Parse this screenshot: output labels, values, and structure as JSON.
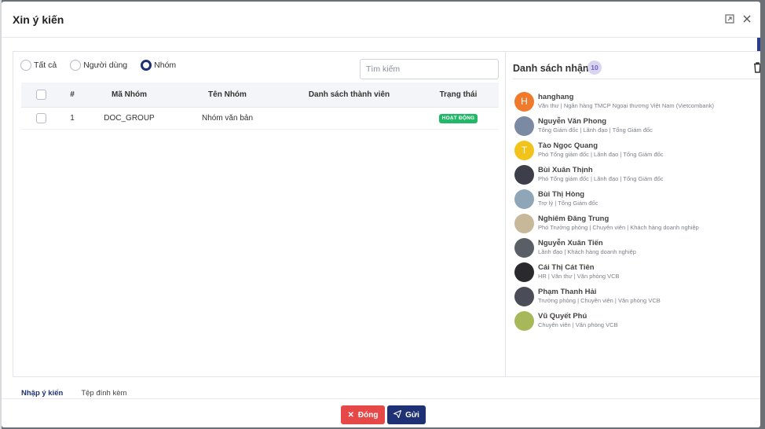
{
  "modal": {
    "title": "Xin ý kiến",
    "expand_icon": "expand-icon",
    "close_icon": "close-icon"
  },
  "filter": {
    "options": [
      "Tất cả",
      "Người dùng",
      "Nhóm"
    ],
    "selected": "Nhóm",
    "search_placeholder": "Tìm kiếm"
  },
  "table": {
    "headers": [
      "#",
      "Mã Nhóm",
      "Tên Nhóm",
      "Danh sách thành viên",
      "Trạng thái"
    ],
    "rows": [
      {
        "num": "1",
        "code": "DOC_GROUP",
        "name": "Nhóm văn bản",
        "members": "",
        "status": "HOẠT ĐỘNG"
      }
    ]
  },
  "recipients_panel": {
    "title": "Danh sách nhận",
    "count": "10",
    "items": [
      {
        "initial": "H",
        "color": "#ef7a2b",
        "name": "hanghang",
        "desc": "Văn thư | Ngân hàng TMCP Ngoại thương Việt Nam (Vietcombank)"
      },
      {
        "initial": "",
        "color": "#7a8aa3",
        "name": "Nguyễn Văn Phong",
        "desc": "Tổng Giám đốc | Lãnh đạo | Tổng Giám đốc"
      },
      {
        "initial": "T",
        "color": "#f2c31b",
        "name": "Tào Ngọc Quang",
        "desc": "Phó Tổng giám đốc | Lãnh đạo | Tổng Giám đốc"
      },
      {
        "initial": "",
        "color": "#3c3f4a",
        "name": "Bùi Xuân Thịnh",
        "desc": "Phó Tổng giám đốc | Lãnh đạo | Tổng Giám đốc"
      },
      {
        "initial": "",
        "color": "#8fa6b8",
        "name": "Bùi Thị Hòng",
        "desc": "Trợ lý | Tổng Giám đốc"
      },
      {
        "initial": "",
        "color": "#c8b89a",
        "name": "Nghiêm Đăng Trung",
        "desc": "Phó Trưởng phòng | Chuyên viên | Khách hàng doanh nghiệp"
      },
      {
        "initial": "",
        "color": "#5a5e66",
        "name": "Nguyễn Xuân Tiến",
        "desc": "Lãnh đạo | Khách hàng doanh nghiệp"
      },
      {
        "initial": "",
        "color": "#2a2a2e",
        "name": "Cái Thị Cát Tiên",
        "desc": "HR | Văn thư | Văn phòng VCB"
      },
      {
        "initial": "",
        "color": "#4a4d57",
        "name": "Phạm Thanh Hải",
        "desc": "Trưởng phòng | Chuyên viên | Văn phòng VCB"
      },
      {
        "initial": "",
        "color": "#a7b85a",
        "name": "Vũ Quyết Phú",
        "desc": "Chuyên viên | Văn phòng VCB"
      }
    ]
  },
  "tabs": [
    "Nhập ý kiến",
    "Tệp đính kèm"
  ],
  "footer": {
    "close_label": "Đóng",
    "send_label": "Gửi"
  }
}
